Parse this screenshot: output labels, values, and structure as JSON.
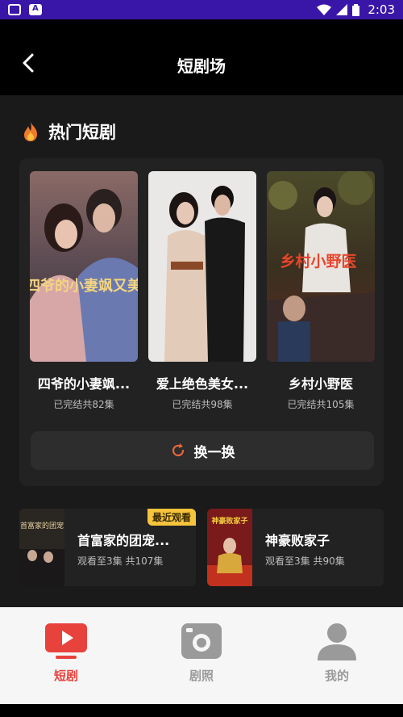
{
  "status_bar": {
    "time": "2:03"
  },
  "header": {
    "title": "短剧场"
  },
  "hot": {
    "title": "热门短剧",
    "items": [
      {
        "name": "四爷的小妻飒...",
        "sub": "已完结共82集",
        "poster_text": "四爷的小妻飒又美"
      },
      {
        "name": "爱上绝色美女...",
        "sub": "已完结共98集",
        "poster_text": ""
      },
      {
        "name": "乡村小野医",
        "sub": "已完结共105集",
        "poster_text": "乡村小野医"
      }
    ],
    "refresh_label": "换一换"
  },
  "recent": [
    {
      "title": "首富家的团宠...",
      "sub": "观看至3集 共107集",
      "badge": "最近观看",
      "thumb_text": "首富家的团宠"
    },
    {
      "title": "神豪败家子",
      "sub": "观看至3集 共90集",
      "thumb_text": "神豪败家子"
    }
  ],
  "tabs": [
    {
      "label": "短剧",
      "active": true
    },
    {
      "label": "剧照",
      "active": false
    },
    {
      "label": "我的",
      "active": false
    }
  ],
  "colors": {
    "accent": "#e8423c",
    "badge": "#f5c43c",
    "status_bar": "#3a16a8"
  }
}
